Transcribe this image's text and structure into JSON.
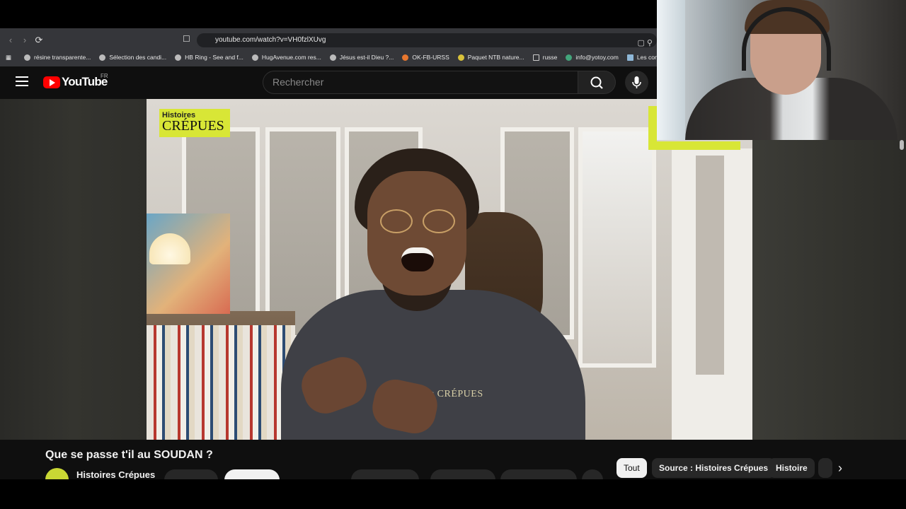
{
  "browser": {
    "url": "youtube.com/watch?v=VH0fzlXUvg",
    "bookmarks": [
      "résine transparente...",
      "Sélection des candi...",
      "HB Ring - See and f...",
      "HugAvenue.com res...",
      "Jésus est-il Dieu ?...",
      "OK-FB-URSS",
      "Paquet NTB nature...",
      "russe",
      "info@yotoy.com",
      "Les concours d'a"
    ]
  },
  "header": {
    "logo_text": "YouTube",
    "country": "FR",
    "search_placeholder": "Rechercher"
  },
  "video": {
    "overlay_tag_line1": "Histoires",
    "overlay_tag_line2": "CRÉPUES",
    "shirt_print": "es CRÉPUES"
  },
  "info": {
    "title": "Que se passe t'il au SOUDAN ?",
    "channel_name": "Histoires Crépues"
  },
  "chips": [
    "Tout",
    "Source : Histoires Crépues",
    "Histoire"
  ],
  "colors": {
    "brand_red": "#ff0000",
    "accent_yellow": "#d8e636",
    "background": "#0f0f0f"
  }
}
